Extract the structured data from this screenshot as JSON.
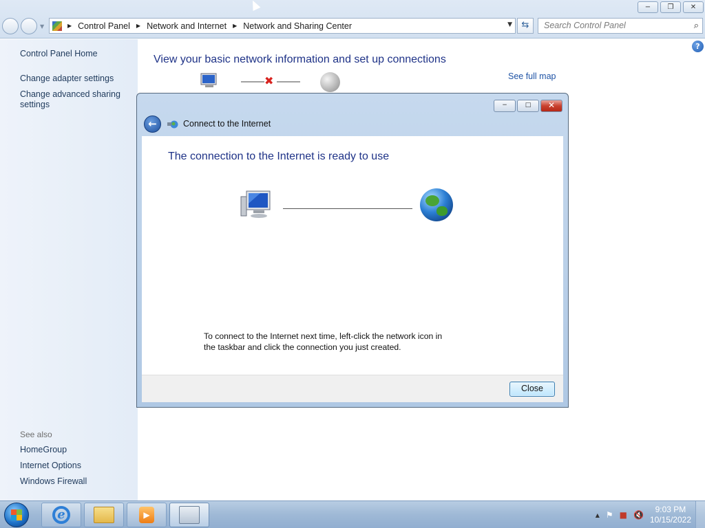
{
  "window": {
    "minimize_label": "−",
    "maximize_label": "❐",
    "close_label": "✕"
  },
  "address_bar": {
    "breadcrumbs": [
      "Control Panel",
      "Network and Internet",
      "Network and Sharing Center"
    ],
    "refresh_icon": "⇆",
    "dropdown_icon": "▼"
  },
  "search": {
    "placeholder": "Search Control Panel",
    "icon": "⌕"
  },
  "left_pane": {
    "links": [
      "Control Panel Home",
      "Change adapter settings",
      "Change advanced sharing settings"
    ],
    "see_also_label": "See also",
    "see_also_links": [
      "HomeGroup",
      "Internet Options",
      "Windows Firewall"
    ]
  },
  "main": {
    "title": "View your basic network information and set up connections",
    "see_full_map": "See full map",
    "help_label": "?",
    "connection_status": "✖"
  },
  "dialog": {
    "title": "Connect to the Internet",
    "back_label": "←",
    "heading": "The connection to the Internet is ready to use",
    "note": "To connect to the Internet next time, left-click the network icon in the taskbar and click the connection you just created.",
    "close_button": "Close",
    "min_label": "−",
    "max_label": "□",
    "close_x": "✕"
  },
  "taskbar": {
    "ie_label": "e",
    "media_label": "▶",
    "tray_icons": [
      "▲",
      "⚑",
      "■",
      "🔇"
    ],
    "time": "9:03 PM",
    "date": "10/15/2022"
  }
}
